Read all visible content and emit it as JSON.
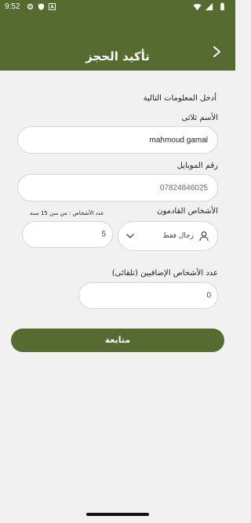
{
  "status_bar": {
    "time": "9:52"
  },
  "header": {
    "title": "تأكيد الحجز"
  },
  "form": {
    "intro": "أدخل المعلومات التالية",
    "name_label": "الأسم ثلاثى",
    "name_value": "mahmoud gamal",
    "mobile_label": "رقم الموبايل",
    "mobile_value": "07824846025",
    "persons_label": "الأشخاص القادمون",
    "persons_type_value": "رجال فقط",
    "count_hint": "عدد الأشخاص : من سن 15 سنه",
    "count_value": "5",
    "extra_label": "عدد الأشخاص الإضافيين (تلقائى)",
    "extra_value": "0"
  },
  "actions": {
    "continue_label": "متابعة"
  },
  "colors": {
    "primary": "#556b2f",
    "background": "#f1f1f1"
  }
}
